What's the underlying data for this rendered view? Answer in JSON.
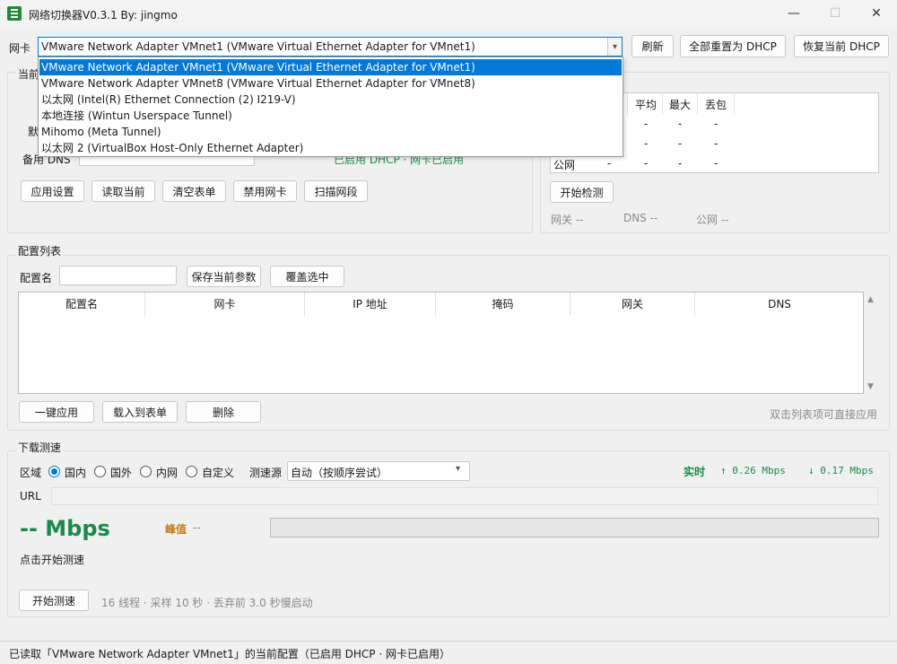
{
  "window": {
    "title": "网络切换器V0.3.1   By: jingmo",
    "minimize": "—",
    "maximize": "☐",
    "close": "✕"
  },
  "toolbar": {
    "nic_label": "网卡",
    "nic_selected": "VMware Network Adapter VMnet1   (VMware Virtual Ethernet Adapter for VMnet1)",
    "refresh": "刷新",
    "reset_all_dhcp": "全部重置为 DHCP",
    "restore_dhcp": "恢复当前 DHCP"
  },
  "nic_dropdown": {
    "options": [
      "VMware Network Adapter VMnet1   (VMware Virtual Ethernet Adapter for VMnet1)",
      "VMware Network Adapter VMnet8   (VMware Virtual Ethernet Adapter for VMnet8)",
      "以太网   (Intel(R) Ethernet Connection (2) I219-V)",
      "本地连接   (Wintun Userspace Tunnel)",
      "Mihomo   (Meta Tunnel)",
      "以太网 2   (VirtualBox Host-Only Ethernet Adapter)"
    ]
  },
  "current_config": {
    "legend_partial": "当前",
    "default_partial": "默",
    "backup_dns_label": "备用 DNS",
    "status_text": "已启用 DHCP · 网卡已启用",
    "buttons": [
      "应用设置",
      "读取当前",
      "清空表单",
      "禁用网卡",
      "扫描网段"
    ]
  },
  "ping": {
    "headers": [
      "平均",
      "最大",
      "丢包"
    ],
    "rows": [
      {
        "name": "",
        "values": [
          "-",
          "-",
          "-"
        ]
      },
      {
        "name": "",
        "values": [
          "-",
          "-",
          "-"
        ]
      },
      {
        "name": "公网",
        "first": "-",
        "values": [
          "-",
          "-",
          "-"
        ]
      }
    ],
    "start_button": "开始检测",
    "gateway_status": "网关 --",
    "dns_status": "DNS --",
    "public_status": "公网 --"
  },
  "config_list": {
    "legend": "配置列表",
    "name_label": "配置名",
    "name_value": "",
    "save_button": "保存当前参数",
    "overwrite_button": "覆盖选中",
    "columns": [
      "配置名",
      "网卡",
      "IP 地址",
      "掩码",
      "网关",
      "DNS"
    ],
    "apply_button": "一键应用",
    "load_button": "载入到表单",
    "delete_button": "删除",
    "hint": "双击列表项可直接应用"
  },
  "speedtest": {
    "legend": "下载测速",
    "region_label": "区域",
    "regions": [
      "国内",
      "国外",
      "内网",
      "自定义"
    ],
    "selected_region": "国内",
    "source_label": "测速源",
    "source_value": "自动（按顺序尝试）",
    "realtime_label": "实时",
    "up_rate": "↑ 0.26 Mbps",
    "down_rate": "↓ 0.17 Mbps",
    "url_label": "URL",
    "url_value": "",
    "speed_value": "-- Mbps",
    "peak_label": "峰值",
    "peak_value": "--",
    "hint": "点击开始测速",
    "progress": 0,
    "start_button": "开始测速",
    "params": "16 线程 · 采样 10 秒 · 丢弃前 3.0 秒慢启动"
  },
  "status_bar": {
    "text": "已读取「VMware Network Adapter VMnet1」的当前配置（已启用 DHCP · 网卡已启用）"
  },
  "colors": {
    "accent": "#0078d4",
    "green": "#1a8a4a",
    "peak": "#c87a1a"
  }
}
